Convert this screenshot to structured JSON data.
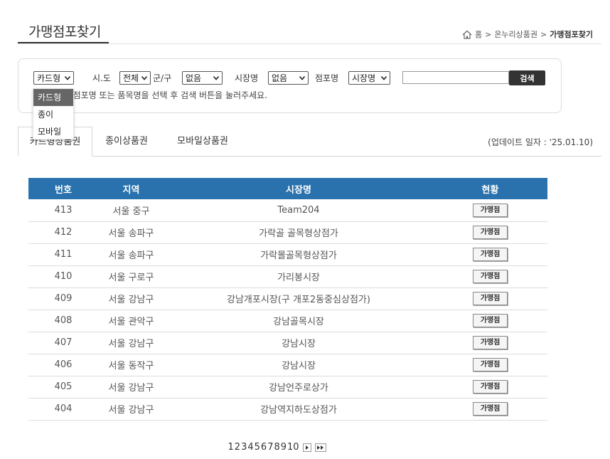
{
  "header": {
    "title": "가맹점포찾기",
    "breadcrumb": [
      "홈",
      "온누리상품권",
      "가맹점포찾기"
    ]
  },
  "search": {
    "card_type": {
      "value": "카드형",
      "options": [
        "카드형",
        "종이",
        "모바일"
      ]
    },
    "sido": {
      "label": "시.도",
      "value": "전체"
    },
    "gungu": {
      "label": "군/구",
      "value": "없음"
    },
    "market": {
      "label": "시장명",
      "value": "없음"
    },
    "store": {
      "label": "점포명",
      "value": "시장명"
    },
    "keyword": "",
    "button_label": "검색",
    "hint": "는 시장명, 점포명 또는 품목명을 선택 후 검색 버튼을 눌러주세요."
  },
  "tabs": [
    {
      "label": "카드형상품권",
      "active": true
    },
    {
      "label": "종이상품권",
      "active": false
    },
    {
      "label": "모바일상품권",
      "active": false
    }
  ],
  "update_text": "(업데이트 일자 : '25.01.10)",
  "table": {
    "header_color": "#2a72ad",
    "columns": [
      "번호",
      "지역",
      "시장명",
      "현황"
    ],
    "rows": [
      [
        "413",
        "서울 중구",
        "Team204",
        "가맹점"
      ],
      [
        "412",
        "서울 송파구",
        "가락골 골목형상점가",
        "가맹점"
      ],
      [
        "411",
        "서울 송파구",
        "가락몰골목형상점가",
        "가맹점"
      ],
      [
        "410",
        "서울 구로구",
        "가리봉시장",
        "가맹점"
      ],
      [
        "409",
        "서울 강남구",
        "강남개포시장(구 개포2동중심상점가)",
        "가맹점"
      ],
      [
        "408",
        "서울 관악구",
        "강남골목시장",
        "가맹점"
      ],
      [
        "407",
        "서울 강남구",
        "강남시장",
        "가맹점"
      ],
      [
        "406",
        "서울 동작구",
        "강남시장",
        "가맹점"
      ],
      [
        "405",
        "서울 강남구",
        "강남언주로상가",
        "가맹점"
      ],
      [
        "404",
        "서울 강남구",
        "강남역지하도상점가",
        "가맹점"
      ]
    ]
  },
  "pagination": {
    "pages": [
      "1",
      "2",
      "3",
      "4",
      "5",
      "6",
      "7",
      "8",
      "9",
      "10"
    ],
    "next_icon": "next-page-icon",
    "last_icon": "last-page-icon"
  }
}
